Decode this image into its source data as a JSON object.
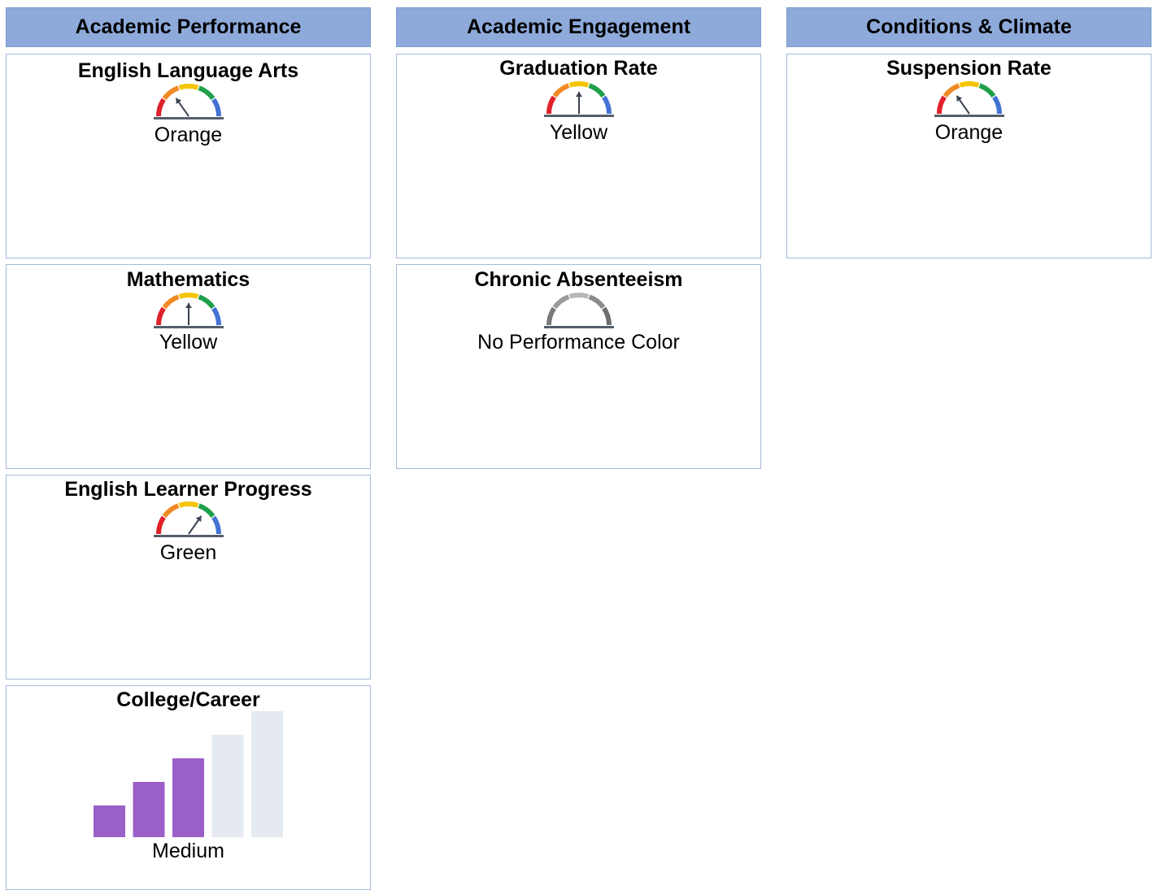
{
  "columns": [
    {
      "header": "Academic Performance"
    },
    {
      "header": "Academic Engagement"
    },
    {
      "header": "Conditions & Climate"
    }
  ],
  "cards": {
    "ela": {
      "title": "English Language Arts",
      "status": "Orange",
      "gauge_icon": "gauge-orange-icon"
    },
    "math": {
      "title": "Mathematics",
      "status": "Yellow",
      "gauge_icon": "gauge-yellow-icon"
    },
    "elp": {
      "title": "English Learner Progress",
      "status": "Green",
      "gauge_icon": "gauge-green-icon"
    },
    "college": {
      "title": "College/Career",
      "status": "Medium",
      "level": 3,
      "levels_total": 5
    },
    "grad": {
      "title": "Graduation Rate",
      "status": "Yellow",
      "gauge_icon": "gauge-yellow-icon"
    },
    "chronic": {
      "title": "Chronic Absenteeism",
      "status": "No Performance Color",
      "gauge_icon": "gauge-gray-icon"
    },
    "suspension": {
      "title": "Suspension Rate",
      "status": "Orange",
      "gauge_icon": "gauge-orange-icon"
    }
  },
  "colors": {
    "header_bg": "#8eaadb",
    "card_border": "#a6b9dc",
    "gauge_red": "#e0202a",
    "gauge_orange": "#f08a24",
    "gauge_yellow": "#f5c400",
    "gauge_green": "#1fa04a",
    "gauge_blue": "#4472d4",
    "bar_filled": "#9b5fc8",
    "bar_empty": "#e5eaf1"
  }
}
